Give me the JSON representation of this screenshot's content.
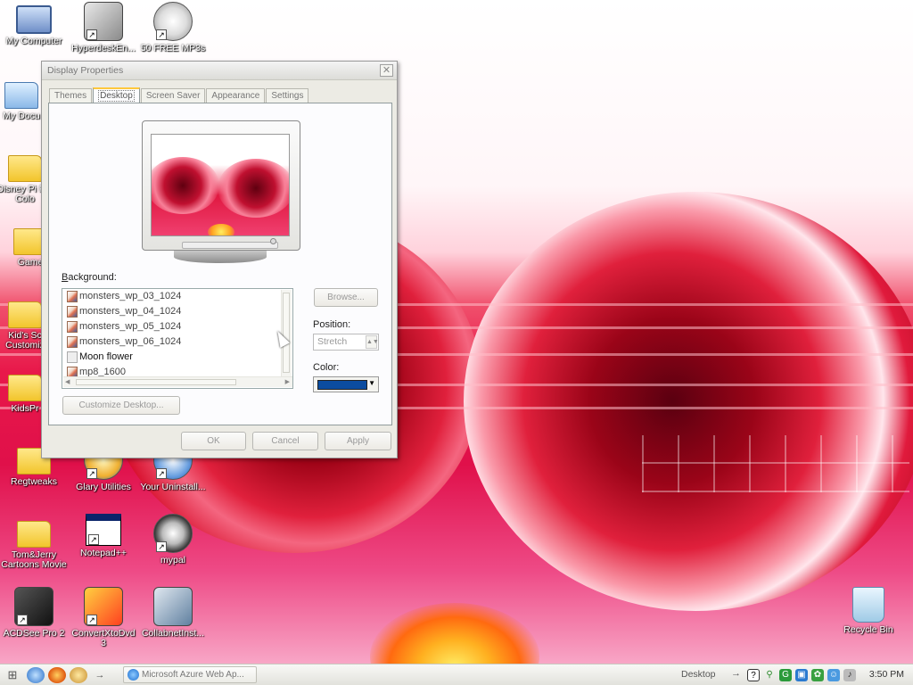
{
  "desktop": {
    "icons": [
      {
        "label": "My Computer",
        "glyph": "computer-icon"
      },
      {
        "label": "HyperdeskEn...",
        "glyph": "hyperdesk-icon"
      },
      {
        "label": "50 FREE MP3s",
        "glyph": "film-reel-icon"
      },
      {
        "label": "My Docu",
        "glyph": "my-documents-icon"
      },
      {
        "label": "Disney Pi For Colo",
        "glyph": "folder-icon"
      },
      {
        "label": "Game",
        "glyph": "folder-icon"
      },
      {
        "label": "Kid's Sc Customiz",
        "glyph": "folder-icon"
      },
      {
        "label": "KidsPr",
        "glyph": "folder-icon"
      },
      {
        "label": "Regtweaks",
        "glyph": "folder-icon"
      },
      {
        "label": "Glary Utilities",
        "glyph": "glary-utilities-icon"
      },
      {
        "label": "Your Uninstall...",
        "glyph": "uninstaller-icon"
      },
      {
        "label": "Tom&Jerry Cartoons Movie",
        "glyph": "folder-icon"
      },
      {
        "label": "Notepad++",
        "glyph": "notepad-icon"
      },
      {
        "label": "mypal",
        "glyph": "raccoon-icon"
      },
      {
        "label": "ACDSee Pro 2",
        "glyph": "acdsee-icon"
      },
      {
        "label": "ConvertXtoDvd 3",
        "glyph": "convertxtodvd-icon"
      },
      {
        "label": "CollabnetInst...",
        "glyph": "network-install-icon"
      },
      {
        "label": "Recycle Bin",
        "glyph": "recycle-bin-icon"
      }
    ]
  },
  "dialog": {
    "title": "Display Properties",
    "close_glyph": "✕",
    "tabs": [
      {
        "label": "Themes",
        "active": false
      },
      {
        "label": "Desktop",
        "active": true
      },
      {
        "label": "Screen Saver",
        "active": false
      },
      {
        "label": "Appearance",
        "active": false
      },
      {
        "label": "Settings",
        "active": false
      }
    ],
    "background_label_prefix": "",
    "background_label_key": "B",
    "background_label_rest": "ackground:",
    "background_items": [
      {
        "label": "monsters_wp_03_1024",
        "icon": "image-file-icon"
      },
      {
        "label": "monsters_wp_04_1024",
        "icon": "image-file-icon"
      },
      {
        "label": "monsters_wp_05_1024",
        "icon": "image-file-icon"
      },
      {
        "label": "monsters_wp_06_1024",
        "icon": "image-file-icon"
      },
      {
        "label": "Moon flower",
        "icon": "image-file-icon"
      },
      {
        "label": "mp8_1600",
        "icon": "image-file-icon"
      }
    ],
    "browse_label": "Browse...",
    "position_label": "Position:",
    "position_value": "Stretch",
    "color_label": "Color:",
    "color_value": "#0b4ca0",
    "customize_label": "Customize Desktop...",
    "ok_label": "OK",
    "cancel_label": "Cancel",
    "apply_label": "Apply"
  },
  "taskbar": {
    "start_glyph": "⊞",
    "quick_launch": [
      "ie-icon",
      "firefox-icon",
      "paint-icon"
    ],
    "more_glyph": "→",
    "task_label": "Microsoft Azure Web Ap...",
    "toolbar_label": "Desktop",
    "toolbar_arrow": "→",
    "clock": "3:50 PM"
  }
}
